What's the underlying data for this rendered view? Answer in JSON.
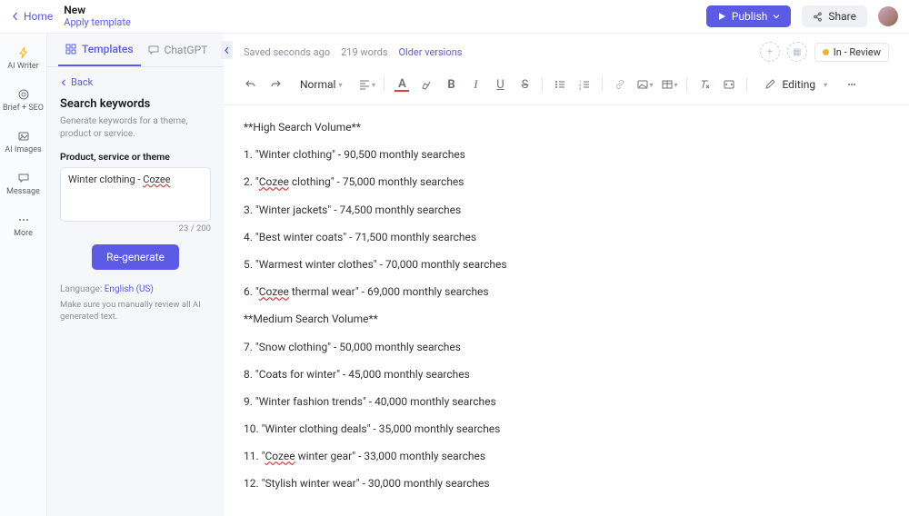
{
  "header": {
    "home": "Home",
    "title": "New",
    "apply_template": "Apply template",
    "publish": "Publish",
    "share": "Share"
  },
  "rail": {
    "ai_writer": "AI Writer",
    "brief_seo": "Brief + SEO",
    "ai_images": "AI Images",
    "message": "Message",
    "more": "More"
  },
  "panel": {
    "tab_templates": "Templates",
    "tab_chatgpt": "ChatGPT",
    "back": "Back",
    "heading": "Search keywords",
    "description": "Generate keywords for a theme, product or service.",
    "field_label": "Product, service or theme",
    "input_pre": "Winter clothing - ",
    "input_spell": "Cozee",
    "counter": "23 / 200",
    "regenerate": "Re-generate",
    "language_label": "Language: ",
    "language_value": "English (US)",
    "note": "Make sure you manually review all AI generated text."
  },
  "status": {
    "saved": "Saved seconds ago",
    "words": "219 words",
    "older": "Older versions",
    "review": "In - Review"
  },
  "toolbar": {
    "normal": "Normal",
    "editing": "Editing"
  },
  "doc": {
    "l1": "**High Search Volume**",
    "l2a": "1. \"Winter clothing\" - 90,500 monthly searches",
    "l3_pre": "2. \"",
    "l3_spell": "Cozee",
    "l3_post": " clothing\" - 75,000 monthly searches",
    "l4": "3. \"Winter jackets\" - 74,500 monthly searches",
    "l5": "4. \"Best winter coats\" - 71,500 monthly searches",
    "l6": "5. \"Warmest winter clothes\" - 70,000 monthly searches",
    "l7_pre": "6. \"",
    "l7_spell": "Cozee",
    "l7_post": " thermal wear\" - 69,000 monthly searches",
    "l8": "**Medium Search Volume**",
    "l9": "7. \"Snow clothing\" - 50,000 monthly searches",
    "l10": "8. \"Coats for winter\" - 45,000 monthly searches",
    "l11": "9. \"Winter fashion trends\" - 40,000 monthly searches",
    "l12": "10.  \"Winter clothing deals\" - 35,000 monthly searches",
    "l13_pre": "11. \"",
    "l13_spell": "Cozee",
    "l13_post": " winter gear\" - 33,000 monthly searches",
    "l14": "12. \"Stylish winter wear\" - 30,000 monthly searches"
  }
}
